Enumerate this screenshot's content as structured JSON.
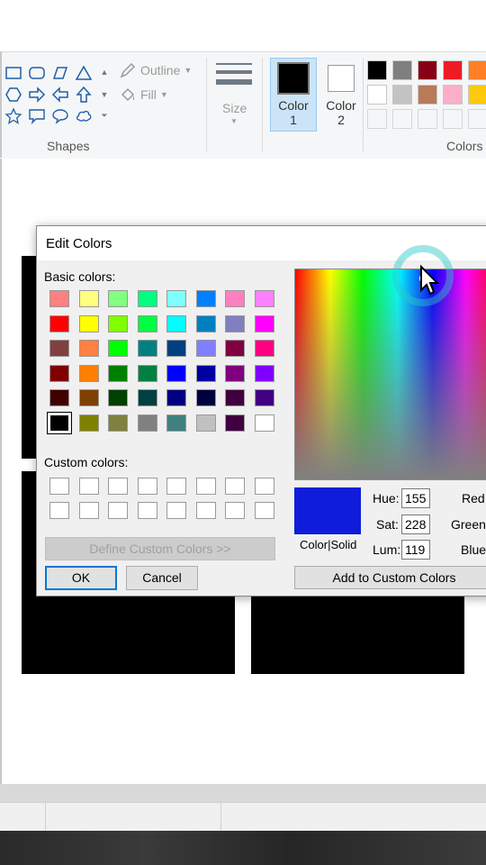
{
  "ribbon": {
    "outline_label": "Outline",
    "fill_label": "Fill",
    "size_label": "Size",
    "shapes_group_label": "Shapes",
    "colors_group_label": "Colors",
    "color1": {
      "line1": "Color",
      "line2": "1",
      "value": "#000000"
    },
    "color2": {
      "line1": "Color",
      "line2": "2",
      "value": "#ffffff"
    },
    "palette_row1": [
      "#000000",
      "#7f7f7f",
      "#880015",
      "#ed1c24",
      "#ff7f27"
    ],
    "palette_row2": [
      "#ffffff",
      "#c3c3c3",
      "#b97a57",
      "#ffaec9",
      "#ffc90e"
    ],
    "palette_row3": [
      "",
      "",
      "",
      "",
      ""
    ]
  },
  "dialog": {
    "title": "Edit Colors",
    "basic_colors_label": "Basic colors:",
    "custom_colors_label": "Custom colors:",
    "basic_colors": [
      [
        "#ff8080",
        "#ffff80",
        "#80ff80",
        "#00ff80",
        "#80ffff",
        "#0080ff",
        "#ff80c0",
        "#ff80ff"
      ],
      [
        "#ff0000",
        "#ffff00",
        "#80ff00",
        "#00ff40",
        "#00ffff",
        "#0080c0",
        "#8080c0",
        "#ff00ff"
      ],
      [
        "#804040",
        "#ff8040",
        "#00ff00",
        "#008080",
        "#004080",
        "#8080ff",
        "#800040",
        "#ff0080"
      ],
      [
        "#800000",
        "#ff8000",
        "#008000",
        "#008040",
        "#0000ff",
        "#0000a0",
        "#800080",
        "#8000ff"
      ],
      [
        "#400000",
        "#804000",
        "#004000",
        "#004040",
        "#000080",
        "#000040",
        "#400040",
        "#400080"
      ],
      [
        "#000000",
        "#808000",
        "#808040",
        "#808080",
        "#408080",
        "#c0c0c0",
        "#400040",
        "#ffffff"
      ]
    ],
    "define_custom_label": "Define Custom Colors >>",
    "ok_label": "OK",
    "cancel_label": "Cancel",
    "color_solid_label": "Color|Solid",
    "preview_color": "#0f1ddb",
    "hue_label": "Hue:",
    "hue_value": "155",
    "sat_label": "Sat:",
    "sat_value": "228",
    "lum_label": "Lum:",
    "lum_value": "119",
    "red_label": "Red",
    "green_label": "Green",
    "blue_label": "Blue",
    "add_custom_label": "Add to Custom Colors"
  }
}
